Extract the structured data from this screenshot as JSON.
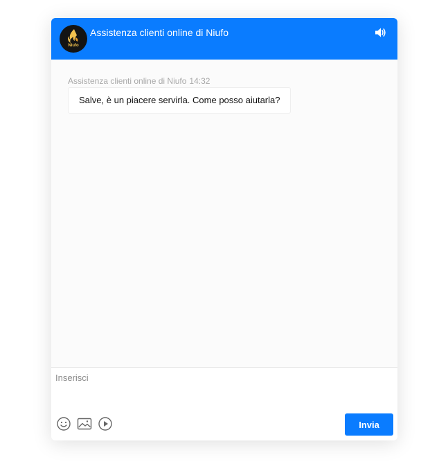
{
  "header": {
    "title": "Assistenza clienti online di Niufo",
    "logo_text": "Niufo",
    "logo_icon": "niufo-flame-logo",
    "sound_icon": "speaker-volume-icon"
  },
  "messages": [
    {
      "sender": "Assistenza clienti online di Niufo",
      "time": "14:32",
      "text": "Salve, è un piacere servirla. Come posso aiutarla?"
    }
  ],
  "composer": {
    "placeholder": "Inserisci",
    "value": "",
    "send_label": "Invia",
    "tools": [
      "emoji-icon",
      "image-icon",
      "video-icon"
    ]
  },
  "colors": {
    "accent": "#0a7cff",
    "logo_bg": "#141414",
    "logo_gold": "#f2c14e"
  }
}
